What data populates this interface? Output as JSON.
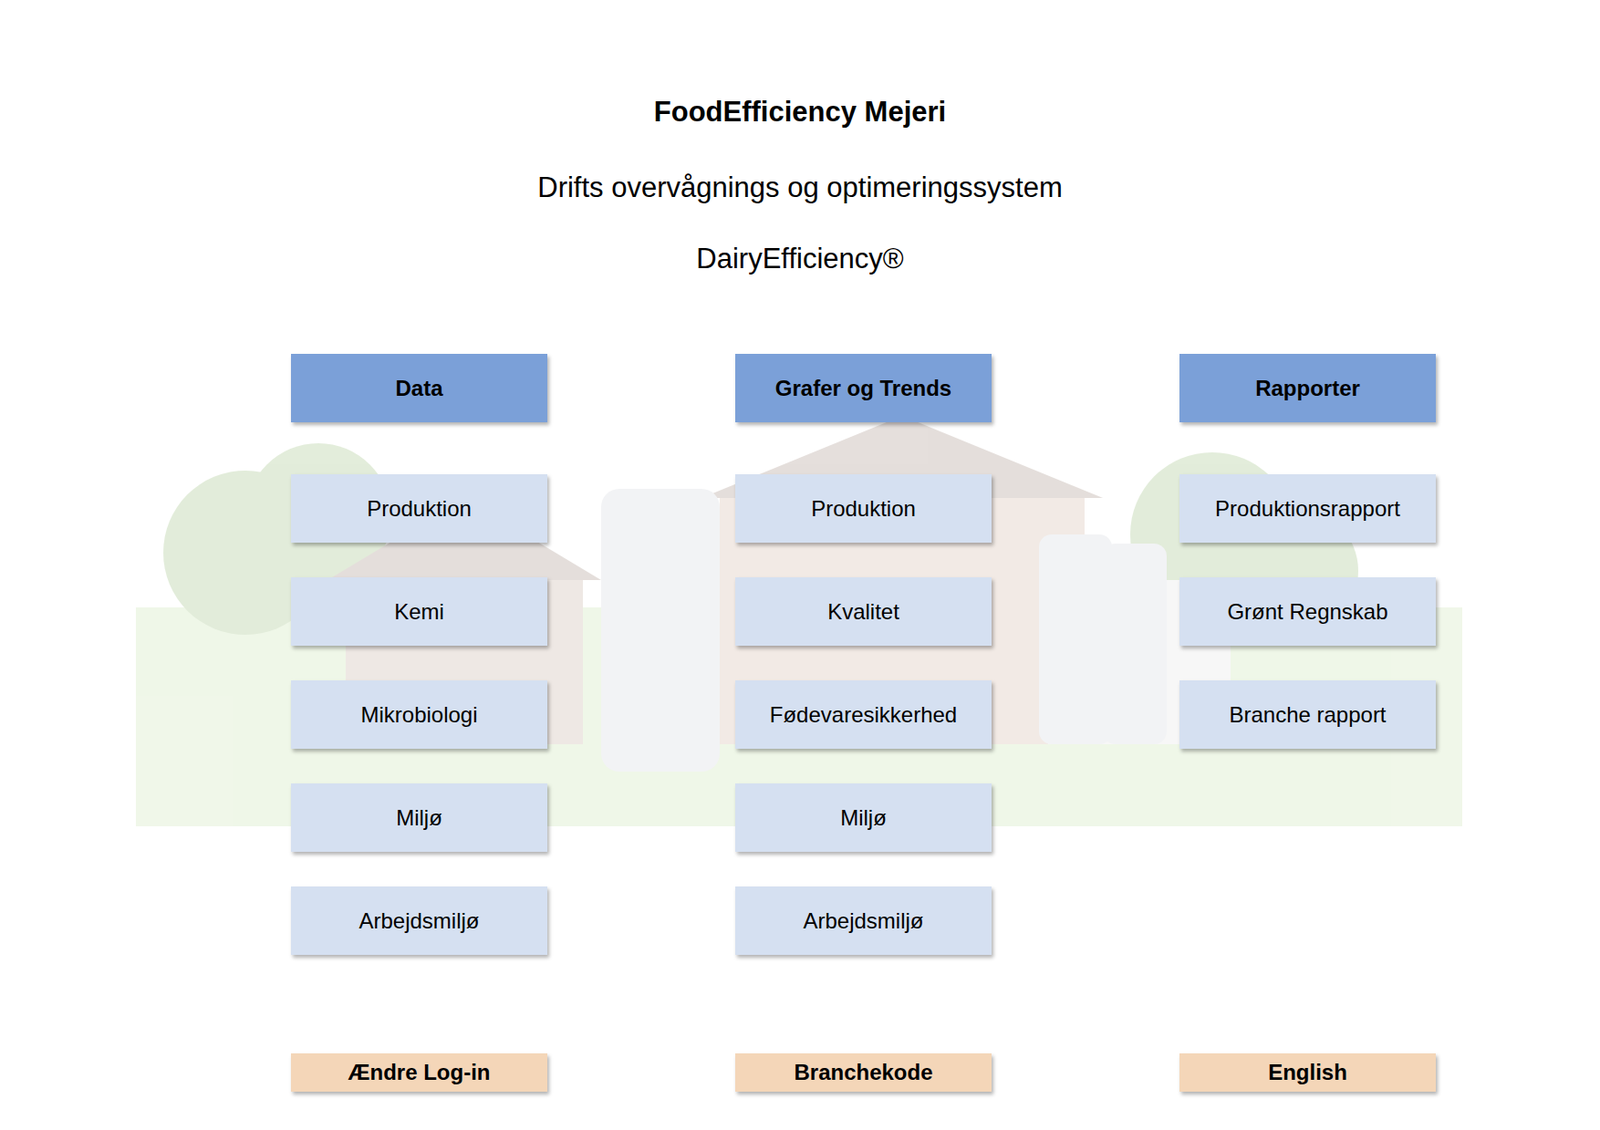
{
  "header": {
    "title": "FoodEfficiency Mejeri",
    "subtitle": "Drifts overvågnings og optimeringssystem",
    "brand": "DairyEfficiency®"
  },
  "columns": [
    {
      "header": "Data",
      "items": [
        "Produktion",
        "Kemi",
        "Mikrobiologi",
        "Miljø",
        "Arbejdsmiljø"
      ]
    },
    {
      "header": "Grafer og Trends",
      "items": [
        "Produktion",
        "Kvalitet",
        "Fødevaresikkerhed",
        "Miljø",
        "Arbejdsmiljø"
      ]
    },
    {
      "header": "Rapporter",
      "items": [
        "Produktionsrapport",
        "Grønt Regnskab",
        "Branche rapport"
      ]
    }
  ],
  "footer_buttons": [
    "Ændre Log-in",
    "Branchekode",
    "English"
  ]
}
